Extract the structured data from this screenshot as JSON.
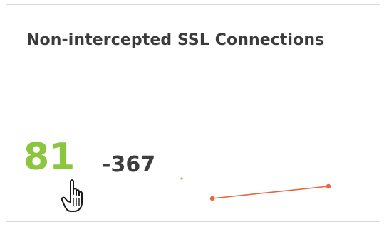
{
  "widget": {
    "title": "Non-intercepted SSL Connections",
    "value": "81",
    "delta": "-367",
    "colors": {
      "value": "#8cc63f",
      "trend_line": "#e8643c",
      "title": "#3b3b3b"
    }
  },
  "cursor": {
    "icon": "hand-pointer-icon"
  }
}
